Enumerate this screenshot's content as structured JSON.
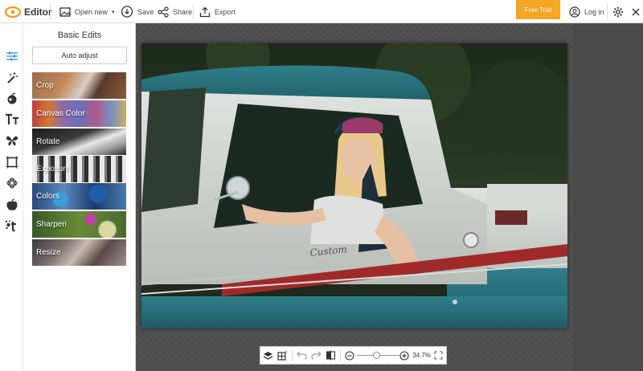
{
  "app": {
    "title": "Editor"
  },
  "toolbar": {
    "open_new": "Open new",
    "save": "Save",
    "share": "Share",
    "export": "Export",
    "free_trial": "Free Trial",
    "login": "Log in"
  },
  "panel": {
    "title": "Basic Edits",
    "auto_adjust": "Auto adjust",
    "items": [
      {
        "label": "Crop"
      },
      {
        "label": "Canvas Color"
      },
      {
        "label": "Rotate"
      },
      {
        "label": "Exposure"
      },
      {
        "label": "Colors"
      },
      {
        "label": "Sharpen"
      },
      {
        "label": "Resize"
      }
    ]
  },
  "rail": {
    "icons": [
      "sliders-icon",
      "magic-wand-icon",
      "cherry-icon",
      "text-icon",
      "butterfly-icon",
      "frame-icon",
      "texture-icon",
      "apple-icon",
      "sticker-text-icon"
    ]
  },
  "zoom": {
    "value": "34.7%",
    "level": 0.347
  },
  "colors": {
    "accent": "#f5a623",
    "logo": "#f39c12"
  }
}
